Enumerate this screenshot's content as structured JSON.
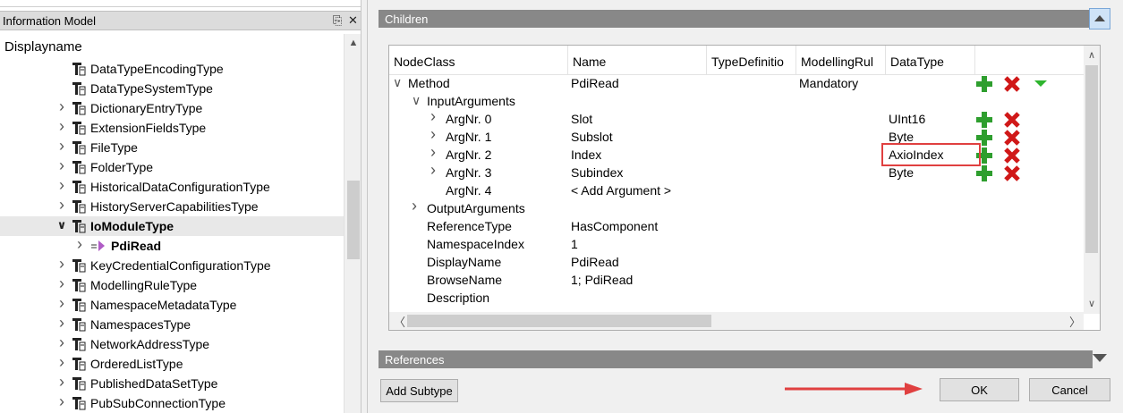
{
  "left_panel": {
    "title": "Information Model",
    "pin_icon": "pin-icon",
    "close_icon": "close-icon",
    "column_header": "Displayname",
    "items": [
      {
        "label": "DataTypeEncodingType",
        "expander": false,
        "bold": false
      },
      {
        "label": "DataTypeSystemType",
        "expander": false,
        "bold": false
      },
      {
        "label": "DictionaryEntryType",
        "expander": true,
        "bold": false
      },
      {
        "label": "ExtensionFieldsType",
        "expander": true,
        "bold": false
      },
      {
        "label": "FileType",
        "expander": true,
        "bold": false
      },
      {
        "label": "FolderType",
        "expander": true,
        "bold": false
      },
      {
        "label": "HistoricalDataConfigurationType",
        "expander": true,
        "bold": false
      },
      {
        "label": "HistoryServerCapabilitiesType",
        "expander": true,
        "bold": false
      },
      {
        "label": "IoModuleType",
        "expander": true,
        "expanded": true,
        "bold": true,
        "selected": true
      },
      {
        "label": "PdiRead",
        "expander": true,
        "bold": true,
        "method": true
      },
      {
        "label": "KeyCredentialConfigurationType",
        "expander": true,
        "bold": false
      },
      {
        "label": "ModellingRuleType",
        "expander": true,
        "bold": false
      },
      {
        "label": "NamespaceMetadataType",
        "expander": true,
        "bold": false
      },
      {
        "label": "NamespacesType",
        "expander": true,
        "bold": false
      },
      {
        "label": "NetworkAddressType",
        "expander": true,
        "bold": false
      },
      {
        "label": "OrderedListType",
        "expander": true,
        "bold": false
      },
      {
        "label": "PublishedDataSetType",
        "expander": true,
        "bold": false
      },
      {
        "label": "PubSubConnectionType",
        "expander": true,
        "bold": false
      }
    ]
  },
  "children": {
    "title": "Children",
    "columns": [
      "NodeClass",
      "Name",
      "TypeDefinitio",
      "ModellingRul",
      "DataType"
    ],
    "rows": [
      {
        "indent": 0,
        "expander": "down",
        "nodeclass": "Method",
        "name": "PdiRead",
        "modelling": "Mandatory",
        "datatype": "",
        "plus": true,
        "x": true,
        "tri": true
      },
      {
        "indent": 1,
        "expander": "down",
        "nodeclass": "InputArguments",
        "name": "",
        "modelling": "",
        "datatype": ""
      },
      {
        "indent": 2,
        "expander": "right",
        "nodeclass": "ArgNr. 0",
        "name": "Slot",
        "modelling": "",
        "datatype": "UInt16",
        "plus": true,
        "x": true
      },
      {
        "indent": 2,
        "expander": "right",
        "nodeclass": "ArgNr. 1",
        "name": "Subslot",
        "modelling": "",
        "datatype": "Byte",
        "plus": true,
        "x": true
      },
      {
        "indent": 2,
        "expander": "right",
        "nodeclass": "ArgNr. 2",
        "name": "Index",
        "modelling": "",
        "datatype": "AxioIndex",
        "plus": true,
        "x": true
      },
      {
        "indent": 2,
        "expander": "right",
        "nodeclass": "ArgNr. 3",
        "name": "Subindex",
        "modelling": "",
        "datatype": "Byte",
        "plus": true,
        "x": true
      },
      {
        "indent": 2,
        "expander": "",
        "nodeclass": "ArgNr. 4",
        "name": "< Add Argument >",
        "modelling": "",
        "datatype": ""
      },
      {
        "indent": 1,
        "expander": "right",
        "nodeclass": "OutputArguments",
        "name": "",
        "modelling": "",
        "datatype": ""
      },
      {
        "indent": 1,
        "expander": "",
        "nodeclass": "ReferenceType",
        "name": "HasComponent",
        "modelling": "",
        "datatype": ""
      },
      {
        "indent": 1,
        "expander": "",
        "nodeclass": "NamespaceIndex",
        "name": "1",
        "modelling": "",
        "datatype": ""
      },
      {
        "indent": 1,
        "expander": "",
        "nodeclass": "DisplayName",
        "name": "PdiRead",
        "modelling": "",
        "datatype": ""
      },
      {
        "indent": 1,
        "expander": "",
        "nodeclass": "BrowseName",
        "name": "1; PdiRead",
        "modelling": "",
        "datatype": ""
      },
      {
        "indent": 1,
        "expander": "",
        "nodeclass": "Description",
        "name": "",
        "modelling": "",
        "datatype": ""
      }
    ]
  },
  "references": {
    "title": "References"
  },
  "buttons": {
    "add_subtype": "Add Subtype",
    "ok": "OK",
    "cancel": "Cancel"
  },
  "colors": {
    "section_bar": "#888888",
    "highlight": "#e04040",
    "plus": "#2e9e2e",
    "delete": "#d01818",
    "arrow": "#e04040"
  }
}
